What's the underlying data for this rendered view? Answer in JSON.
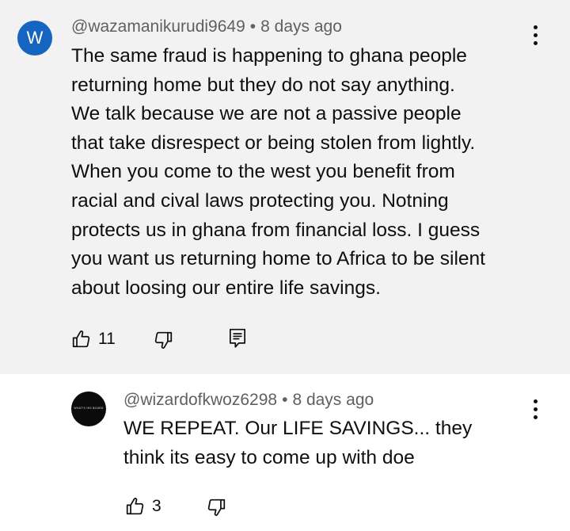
{
  "comment": {
    "avatar_letter": "W",
    "author": "@wazamanikurudi9649",
    "separator": "•",
    "time": "8 days ago",
    "text_lines": [
      "The same fraud is happening to ghana people",
      "returning home but they do not say anything.",
      "We talk because we are not a passive people",
      "that take disrespect or being stolen from lightly.",
      "When you come to the west you benefit from",
      "racial and cival laws protecting you. Notning",
      "protects us in ghana from financial loss. I guess",
      "you want us returning home to Africa to be silent",
      "about loosing our entire life savings."
    ],
    "like_count": "11"
  },
  "reply": {
    "avatar_text": "WHAT'S HIS BOARD",
    "author": "@wizardofkwoz6298",
    "separator": "•",
    "time": "8 days ago",
    "text_lines": [
      "WE REPEAT. Our LIFE SAVINGS... they",
      "think its easy to come up with doe"
    ],
    "like_count": "3"
  },
  "colors": {
    "comment_bg": "#f2f2f2",
    "avatar_blue": "#1565c0",
    "meta_gray": "#606060",
    "text": "#0f0f0f"
  },
  "icons": [
    "thumbs-up-icon",
    "thumbs-down-icon",
    "reply-icon",
    "more-vert-icon"
  ]
}
